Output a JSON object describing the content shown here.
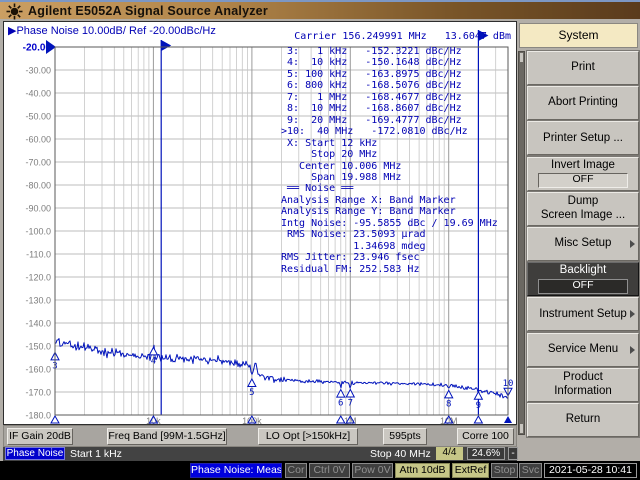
{
  "window": {
    "title": "Agilent E5052A Signal Source Analyzer"
  },
  "trace_header": {
    "marker_arrow": "▶",
    "label": "Phase Noise",
    "scale": "10.00dB/",
    "ref": "Ref -20.00dBc/Hz"
  },
  "carrier_line": "Carrier 156.249991 MHz   13.6047 dBm",
  "chart_data": {
    "type": "line",
    "x_scale": "log",
    "x_range_hz": [
      1000,
      40000000
    ],
    "y_range": [
      -180,
      -20
    ],
    "y_step": 10,
    "y_unit": "dBc/Hz",
    "x_decade_labels": [
      {
        "hz": 10000,
        "label": "10k"
      },
      {
        "hz": 100000,
        "label": "100k"
      },
      {
        "hz": 1000000,
        "label": "1M"
      },
      {
        "hz": 10000000,
        "label": "10M"
      }
    ],
    "band_marker_lines_hz": [
      12000,
      20000000
    ],
    "marker_unit_suffix": "dBc/Hz",
    "markers": [
      {
        "n": 3,
        "freq": "1",
        "unit": "kHz",
        "hz": 1000,
        "value": "-152.3221"
      },
      {
        "n": 4,
        "freq": "10",
        "unit": "kHz",
        "hz": 10000,
        "value": "-150.1648"
      },
      {
        "n": 5,
        "freq": "100",
        "unit": "kHz",
        "hz": 100000,
        "value": "-163.8975"
      },
      {
        "n": 6,
        "freq": "800",
        "unit": "kHz",
        "hz": 800000,
        "value": "-168.5076"
      },
      {
        "n": 7,
        "freq": "1",
        "unit": "MHz",
        "hz": 1000000,
        "value": "-168.4677"
      },
      {
        "n": 8,
        "freq": "10",
        "unit": "MHz",
        "hz": 10000000,
        "value": "-168.8607"
      },
      {
        "n": 9,
        "freq": "20",
        "unit": "MHz",
        "hz": 20000000,
        "value": "-169.4777"
      },
      {
        "n": 10,
        "freq": "40",
        "unit": "MHz",
        "hz": 40000000,
        "value": "-172.0810",
        "active": true
      }
    ],
    "trace_profile": [
      [
        3.0,
        -149.3
      ],
      [
        3.08,
        -148.5
      ],
      [
        3.2,
        -149.6
      ],
      [
        3.35,
        -151.0
      ],
      [
        3.5,
        -152.5
      ],
      [
        3.65,
        -153.5
      ],
      [
        3.8,
        -154.5
      ],
      [
        4.0,
        -155.0
      ],
      [
        4.3,
        -155.5
      ],
      [
        4.6,
        -156.0
      ],
      [
        4.85,
        -157.0
      ],
      [
        4.95,
        -158.5
      ],
      [
        5.0,
        -160.5
      ],
      [
        5.08,
        -162.5
      ],
      [
        5.18,
        -164.2
      ],
      [
        5.3,
        -165.0
      ],
      [
        5.6,
        -165.3
      ],
      [
        5.9,
        -165.8
      ],
      [
        6.0,
        -166.0
      ],
      [
        6.2,
        -166.0
      ],
      [
        6.5,
        -166.3
      ],
      [
        6.8,
        -166.6
      ],
      [
        7.0,
        -167.2
      ],
      [
        7.15,
        -168.0
      ],
      [
        7.3,
        -169.3
      ],
      [
        7.45,
        -170.5
      ],
      [
        7.55,
        -171.5
      ],
      [
        7.602,
        -171.9
      ]
    ],
    "spurs": [
      [
        4.0,
        5.2,
        0.012
      ],
      [
        3.95,
        2.2,
        0.01
      ],
      [
        5.035,
        4.0,
        0.012
      ],
      [
        5.005,
        -3.0,
        0.006
      ],
      [
        5.903,
        -2.6,
        0.006
      ],
      [
        6.0,
        -2.4,
        0.006
      ],
      [
        7.0,
        -1.6,
        0.006
      ],
      [
        3.62,
        2.0,
        0.01
      ]
    ],
    "noise_db": 1.2
  },
  "readout": {
    "x_lines": [
      " X: Start 12 kHz",
      "     Stop 20 MHz",
      "   Center 10.006 MHz",
      "     Span 19.988 MHz"
    ],
    "noise_header": " ══ Noise ══",
    "noise_lines": [
      "Analysis Range X: Band Marker",
      "Analysis Range Y: Band Marker",
      "Intg Noise: -95.5855 dBc / 19.69 MHz",
      " RMS Noise: 23.5093 µrad",
      "            1.34698 mdeg",
      "RMS Jitter: 23.946 fsec",
      "Residual FM: 252.583 Hz"
    ]
  },
  "softkeys": {
    "header": "System",
    "items": [
      {
        "label": "Print"
      },
      {
        "label": "Abort Printing"
      },
      {
        "label": "Printer Setup ..."
      },
      {
        "label": "Invert Image",
        "sub": "OFF"
      },
      {
        "label": "Dump\nScreen Image ..."
      },
      {
        "label": "Misc Setup",
        "arrow": true
      },
      {
        "label": "Backlight",
        "sub": "OFF",
        "dark": true
      },
      {
        "label": "Instrument Setup",
        "arrow": true
      },
      {
        "label": "Service Menu",
        "arrow": true
      },
      {
        "label": "Product\nInformation"
      },
      {
        "label": "Return"
      }
    ]
  },
  "row1_buttons": [
    {
      "label": "IF Gain 20dB"
    },
    {
      "label": "Freq Band [99M-1.5GHz]"
    },
    {
      "label": "LO Opt [>150kHz]"
    },
    {
      "label": "595pts"
    },
    {
      "label": "Corre 100"
    }
  ],
  "row2": {
    "trace_chip": "Phase Noise",
    "start": "Start 1 kHz",
    "stop": "Stop 40 MHz",
    "page": "4/4",
    "percent": "24.6%",
    "minimize": "-"
  },
  "statusbar": [
    {
      "label": "Phase Noise: Meas",
      "style": "meas"
    },
    {
      "label": "Cor",
      "style": "dis"
    },
    {
      "label": "Ctrl 0V",
      "style": "dis"
    },
    {
      "label": "Pow 0V",
      "style": "dis"
    },
    {
      "label": "Attn 10dB",
      "style": "act"
    },
    {
      "label": "ExtRef",
      "style": "act"
    },
    {
      "label": "Stop",
      "style": "dis"
    },
    {
      "label": "Svc",
      "style": "dis"
    },
    {
      "label": "2021-05-28 10:41",
      "style": "time"
    }
  ],
  "colors": {
    "accent_blue": "#0000cc",
    "trace_blue": "#0013bb",
    "khaki": "#c6c687",
    "cream_header": "#f4e9c3",
    "title_gradient": [
      "#cb9f63",
      "#5a3b1c"
    ]
  }
}
